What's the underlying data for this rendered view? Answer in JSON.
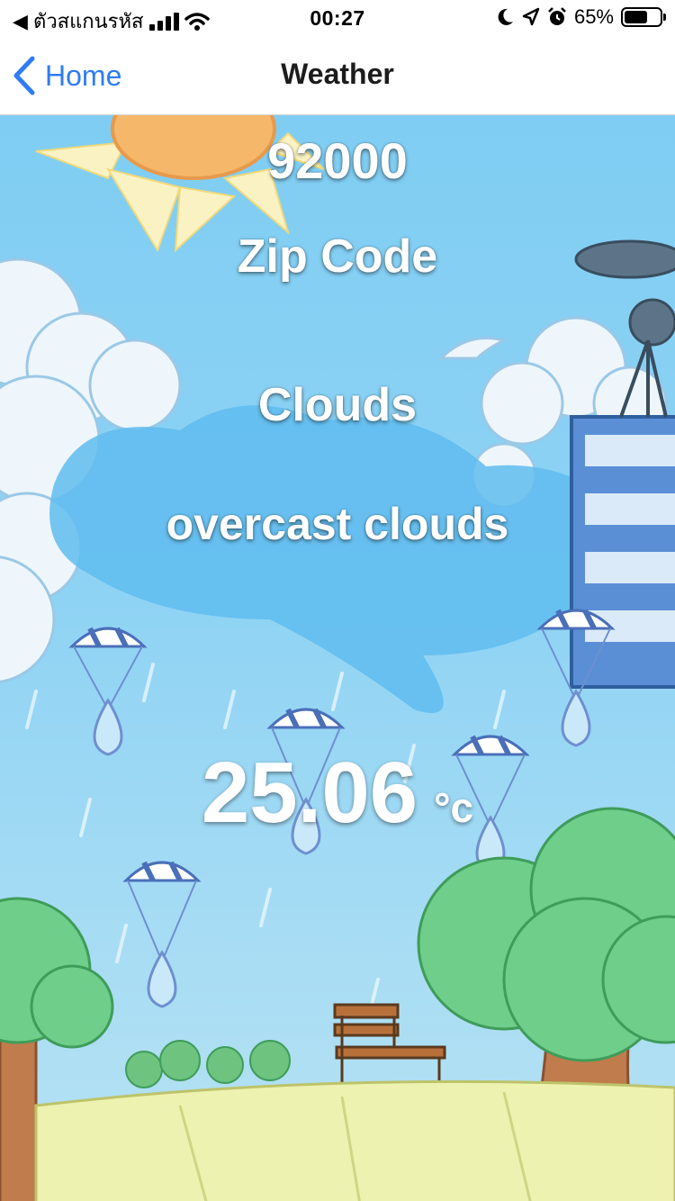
{
  "status_bar": {
    "carrier": "◀ ตัวสแกนรหัส",
    "time": "00:27",
    "battery_percent": "65%",
    "battery_level": 0.65,
    "icons": [
      "signal-icon",
      "wifi-icon",
      "moon-icon",
      "location-icon",
      "alarm-icon",
      "battery-icon"
    ]
  },
  "nav": {
    "back_label": "Home",
    "title": "Weather"
  },
  "weather": {
    "zip": "92000",
    "zip_label": "Zip Code",
    "condition": "Clouds",
    "description": "overcast clouds",
    "temperature": "25.06",
    "unit": "°c"
  },
  "colors": {
    "accent": "#2f7cf6",
    "sky": "#7fcdf3"
  }
}
